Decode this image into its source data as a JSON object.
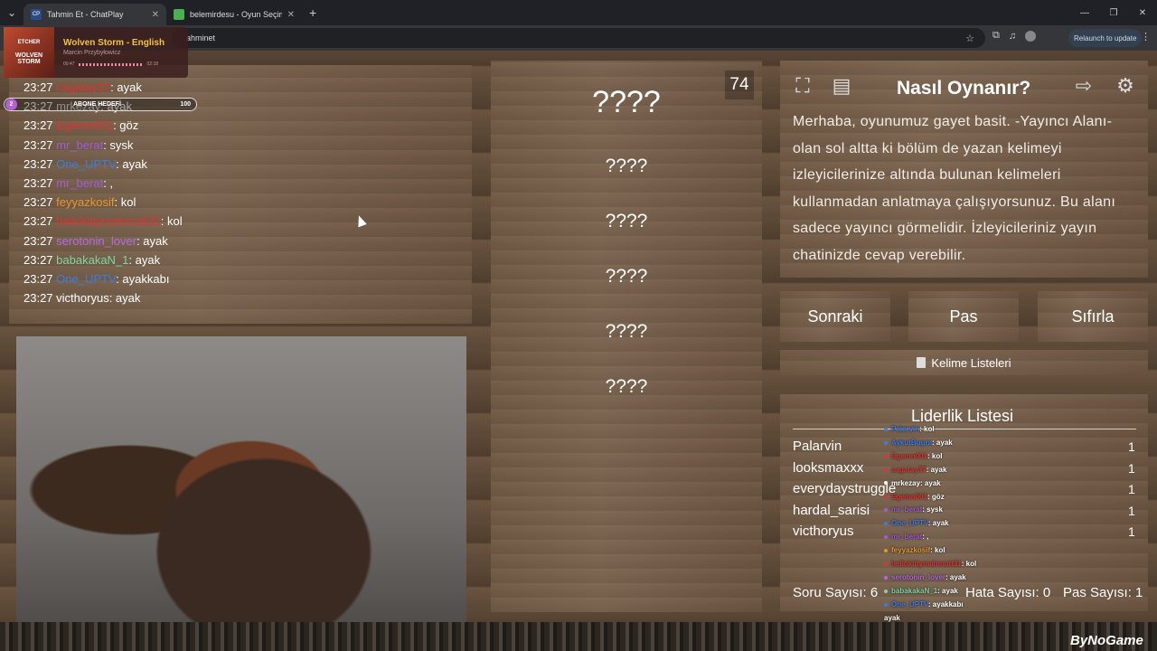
{
  "browser": {
    "tabs": [
      {
        "favicon": "CP",
        "title": "Tahmin Et - ChatPlay",
        "active": true
      },
      {
        "favicon": "",
        "title": "belemirdesu - Oyun Seçimi | ki",
        "active": false
      }
    ],
    "url_visible": "ahminet",
    "relaunch_label": "Relaunch to update"
  },
  "spotify": {
    "art_line1": "ETCHER",
    "art_line2": "WOLVEN STORM",
    "title": "Wolven Storm - English",
    "artist": "Marcin Przybyłowicz",
    "time_current": "00:47",
    "time_total": "02:18"
  },
  "sub_goal": {
    "count_left": "2",
    "label": "ABONE HEDEFİ",
    "value": "100"
  },
  "chat": [
    {
      "time": "23:27",
      "user": "cagatay37",
      "msg": ": ayak",
      "color": "#d33"
    },
    {
      "time": "23:27",
      "user": "mrkezay",
      "msg": ": ayak",
      "color": "#ddd"
    },
    {
      "time": "23:27",
      "user": "Egemn001",
      "msg": ": göz",
      "color": "#d33"
    },
    {
      "time": "23:27",
      "user": "mr_berat",
      "msg": ": sysk",
      "color": "#a35bd6"
    },
    {
      "time": "23:27",
      "user": "One_UPTV",
      "msg": ": ayak",
      "color": "#3b7bea"
    },
    {
      "time": "23:27",
      "user": "mr_berat",
      "msg": ": ,",
      "color": "#a35bd6"
    },
    {
      "time": "23:27",
      "user": "feyyazkosif",
      "msg": ": kol",
      "color": "#e8962a"
    },
    {
      "time": "23:27",
      "user": "hellokittymahmutt31",
      "msg": ": kol",
      "color": "#d33"
    },
    {
      "time": "23:27",
      "user": "serotonin_lover",
      "msg": ": ayak",
      "color": "#b56ae0"
    },
    {
      "time": "23:27",
      "user": "babakakaN_1",
      "msg": ": ayak",
      "color": "#7cd6a6"
    },
    {
      "time": "23:27",
      "user": "One_UPTV",
      "msg": ": ayakkabı",
      "color": "#3b7bea"
    },
    {
      "time": "23:27",
      "user": "victhoryus",
      "msg": ": ayak",
      "color": "#fff"
    }
  ],
  "words": {
    "main": "????",
    "list": [
      "????",
      "????",
      "????",
      "????",
      "????"
    ]
  },
  "timer": "74",
  "howto": {
    "title": "Nasıl Oynanır?",
    "text": "Merhaba, oyunumuz gayet basit. -Yayıncı Alanı- olan sol altta ki bölüm de yazan kelimeyi izleyicilerinize altında bulunan kelimeleri kullanmadan anlatmaya çalışıyorsunuz. Bu alanı sadece yayıncı görmelidir. İzleyicileriniz yayın chatinizde cevap verebilir."
  },
  "buttons": {
    "next": "Sonraki",
    "pass": "Pas",
    "reset": "Sıfırla",
    "lists": "Kelime Listeleri"
  },
  "leaderboard": {
    "title": "Liderlik Listesi",
    "rows": [
      {
        "name": "Palarvin",
        "score": "1"
      },
      {
        "name": "looksmaxxx",
        "score": "1"
      },
      {
        "name": "everydaystruggle",
        "score": "1"
      },
      {
        "name": "hardal_sarisi",
        "score": "1"
      },
      {
        "name": "victhoryus",
        "score": "1"
      }
    ],
    "questions": "Soru Sayısı: 6",
    "errors": "Hata Sayısı: 0",
    "passes": "Pas Sayısı: 1"
  },
  "overlay_chat": [
    {
      "user": "Palarvin",
      "msg": ": kol",
      "color": "#3b7bea"
    },
    {
      "user": "AykutBugra",
      "msg": ": ayak",
      "color": "#3b7bea"
    },
    {
      "user": "Egemn001",
      "msg": ": kol",
      "color": "#d33"
    },
    {
      "user": "cagatay37",
      "msg": ": ayak",
      "color": "#d33"
    },
    {
      "user": "mrkezay",
      "msg": ": ayak",
      "color": "#fff"
    },
    {
      "user": "Egemn001",
      "msg": ": göz",
      "color": "#d33"
    },
    {
      "user": "mr_berat",
      "msg": ": sysk",
      "color": "#a35bd6"
    },
    {
      "user": "One_UPTV",
      "msg": ": ayak",
      "color": "#3b7bea"
    },
    {
      "user": "mr_berat",
      "msg": ": ,",
      "color": "#a35bd6"
    },
    {
      "user": "feyyazkosif",
      "msg": ": kol",
      "color": "#e8962a"
    },
    {
      "user": "hellokittymahmutt31",
      "msg": ": kol",
      "color": "#d33"
    },
    {
      "user": "serotonin_lover",
      "msg": ": ayak",
      "color": "#b56ae0"
    },
    {
      "user": "babakakaN_1",
      "msg": ": ayak",
      "color": "#7cd6a6"
    },
    {
      "user": "One_UPTV",
      "msg": ": ayakkabı",
      "color": "#3b7bea"
    },
    {
      "user": "",
      "msg": "ayak",
      "color": "#fff"
    }
  ],
  "watermark": "ByNoGame"
}
